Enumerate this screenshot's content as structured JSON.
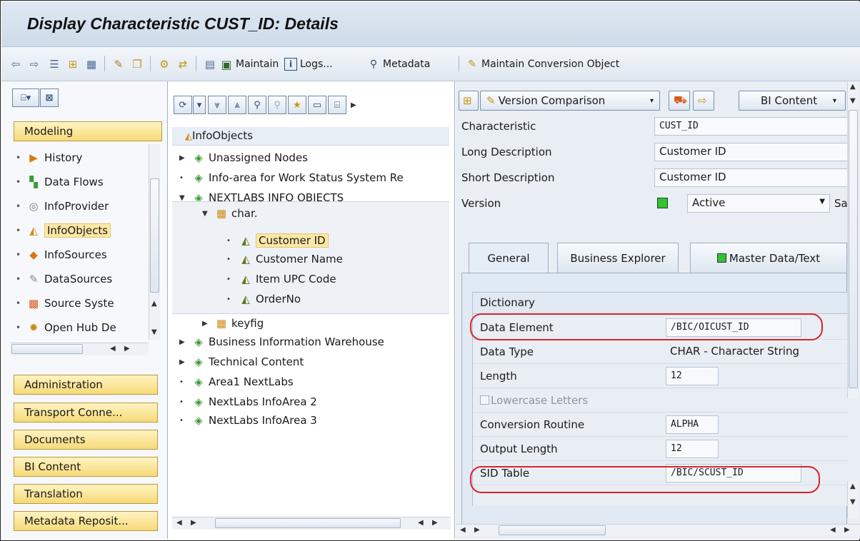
{
  "window": {
    "title": "Display Characteristic CUST_ID: Details"
  },
  "toolbar": {
    "maintain_label": "Maintain",
    "logs_label": "Logs...",
    "metadata_label": "Metadata",
    "conversion_label": "Maintain Conversion Object"
  },
  "left": {
    "modeling_label": "Modeling",
    "nav_items": [
      {
        "label": "History",
        "icon": "history-icon"
      },
      {
        "label": "Data Flows",
        "icon": "dataflow-icon"
      },
      {
        "label": "InfoProvider",
        "icon": "infoprovider-icon"
      },
      {
        "label": "InfoObjects",
        "icon": "infoobject-icon",
        "selected": true
      },
      {
        "label": "InfoSources",
        "icon": "infosource-icon"
      },
      {
        "label": "DataSources",
        "icon": "datasource-icon"
      },
      {
        "label": "Source Syste",
        "icon": "sourcesystem-icon"
      },
      {
        "label": "Open Hub De",
        "icon": "openhub-icon"
      }
    ],
    "bottom_buttons": [
      "Administration",
      "Transport Conne...",
      "Documents",
      "BI Content",
      "Translation",
      "Metadata Reposit..."
    ]
  },
  "tree": {
    "header": "InfoObjects",
    "nodes": [
      {
        "label": "Unassigned Nodes"
      },
      {
        "label": "Info-area for Work Status System Re"
      },
      {
        "label": "NEXTLABS INFO OBJECTS"
      },
      {
        "label": "char."
      },
      {
        "label": "Customer ID",
        "selected": true
      },
      {
        "label": "Customer Name"
      },
      {
        "label": "Item UPC Code"
      },
      {
        "label": "OrderNo"
      },
      {
        "label": "keyfig"
      },
      {
        "label": "Business Information Warehouse"
      },
      {
        "label": "Technical Content"
      },
      {
        "label": "Area1 NextLabs"
      },
      {
        "label": "NextLabs InfoArea 2"
      },
      {
        "label": "NextLabs InfoArea 3"
      }
    ]
  },
  "details": {
    "version_comparison_label": "Version Comparison",
    "bi_content_label": "BI Content",
    "fields": {
      "characteristic": {
        "label": "Characteristic",
        "value": "CUST_ID"
      },
      "long_desc": {
        "label": "Long Description",
        "value": "Customer ID"
      },
      "short_desc": {
        "label": "Short Description",
        "value": "Customer ID"
      },
      "version": {
        "label": "Version",
        "value": "Active",
        "extra": "Sav"
      }
    },
    "tabs": [
      "General",
      "Business Explorer",
      "Master Data/Text"
    ],
    "dictionary": {
      "header": "Dictionary",
      "rows": [
        {
          "label": "Data Element",
          "value": "/BIC/OICUST_ID"
        },
        {
          "label": "Data Type",
          "value": "CHAR - Character String"
        },
        {
          "label": "Length",
          "value": "12"
        },
        {
          "label": "Lowercase Letters",
          "value": ""
        },
        {
          "label": "Conversion Routine",
          "value": "ALPHA"
        },
        {
          "label": "Output Length",
          "value": "12"
        },
        {
          "label": "SID Table",
          "value": "/BIC/SCUST_ID"
        }
      ]
    },
    "highlight_color": "#d9252a",
    "status_green": "#2ec52e"
  }
}
